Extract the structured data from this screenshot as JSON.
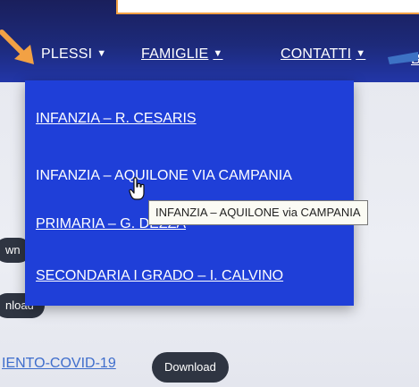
{
  "nav": {
    "items": [
      {
        "label": "PLESSI"
      },
      {
        "label": "FAMIGLIE"
      },
      {
        "label": "CONTATTI"
      }
    ],
    "caret": "▼",
    "cut_item": "B"
  },
  "dropdown": {
    "items": [
      {
        "label": "INFANZIA – R. CESARIS"
      },
      {
        "label": "INFANZIA – AQUILONE VIA CAMPANIA"
      },
      {
        "label": "PRIMARIA – G. DEZZA"
      },
      {
        "label": "SECONDARIA I GRADO – I. CALVINO"
      }
    ]
  },
  "tooltip": {
    "text": "INFANZIA – AQUILONE via CAMPANIA"
  },
  "background": {
    "pill_1": "wn",
    "pill_2": "nload",
    "link": "IENTO-COVID-19",
    "download": "Download"
  },
  "colors": {
    "navbar": "#1d2a7a",
    "dropdown": "#1f3fd8",
    "annotation_arrow": "#f2a144",
    "pill": "#2f3542"
  }
}
